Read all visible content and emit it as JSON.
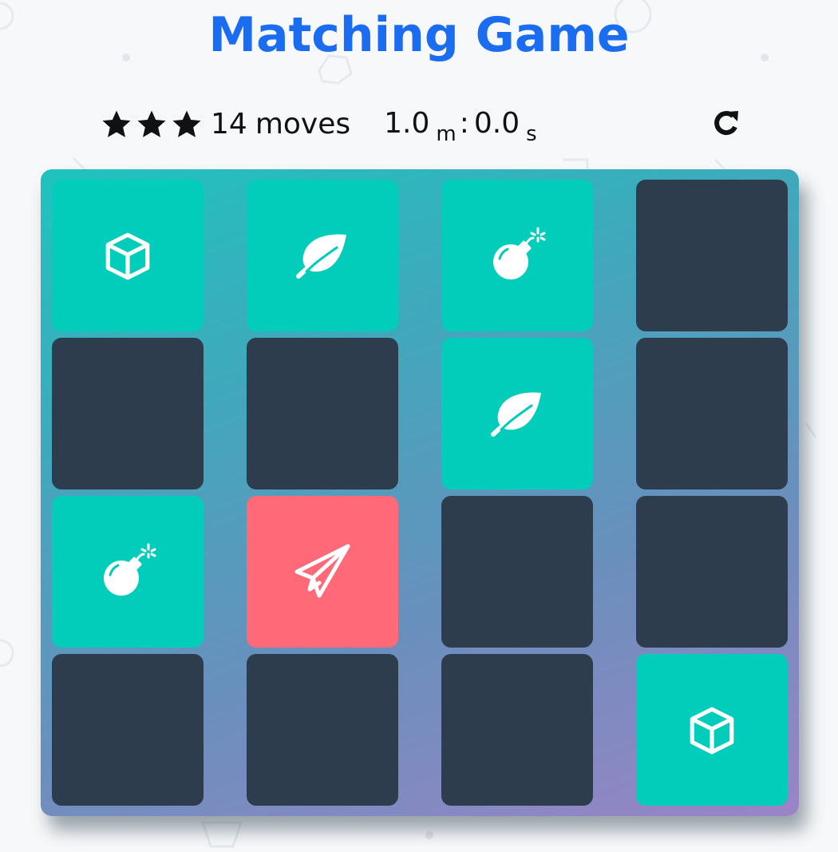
{
  "title": "Matching Game",
  "score_panel": {
    "stars": [
      "star-icon",
      "star-icon",
      "star-icon"
    ],
    "moves_count": "14",
    "moves_label": "moves",
    "timer": {
      "minutes": "1.0",
      "minutes_unit": "m",
      "separator": ":",
      "seconds": "0.0",
      "seconds_unit": "s"
    },
    "restart_icon": "refresh-icon"
  },
  "colors": {
    "title": "#1a6cf0",
    "card_hidden": "#2e3d4d",
    "card_match": "#02ccba",
    "card_open": "#ff6978",
    "deck_gradient_start": "#1fc3be",
    "deck_gradient_end": "#9a84c6"
  },
  "cards": [
    {
      "state": "match",
      "icon": "cube"
    },
    {
      "state": "match",
      "icon": "leaf"
    },
    {
      "state": "match",
      "icon": "bomb"
    },
    {
      "state": "hidden",
      "icon": ""
    },
    {
      "state": "hidden",
      "icon": ""
    },
    {
      "state": "hidden",
      "icon": ""
    },
    {
      "state": "match",
      "icon": "leaf"
    },
    {
      "state": "hidden",
      "icon": ""
    },
    {
      "state": "match",
      "icon": "bomb"
    },
    {
      "state": "open",
      "icon": "paper-plane"
    },
    {
      "state": "hidden",
      "icon": ""
    },
    {
      "state": "hidden",
      "icon": ""
    },
    {
      "state": "hidden",
      "icon": ""
    },
    {
      "state": "hidden",
      "icon": ""
    },
    {
      "state": "hidden",
      "icon": ""
    },
    {
      "state": "match",
      "icon": "cube"
    }
  ]
}
